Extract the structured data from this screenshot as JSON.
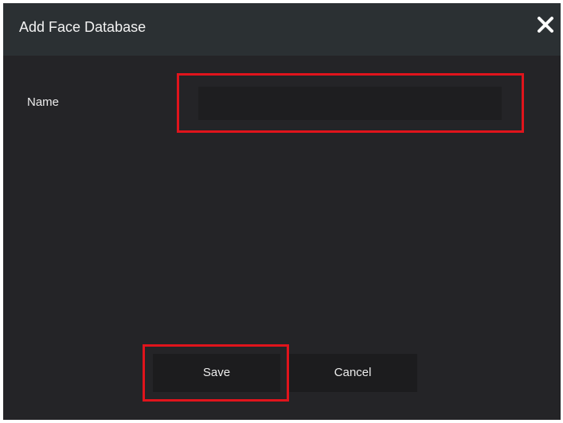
{
  "dialog": {
    "title": "Add Face Database",
    "close_icon": "close-icon"
  },
  "form": {
    "name_label": "Name",
    "name_value": "",
    "name_placeholder": ""
  },
  "buttons": {
    "save_label": "Save",
    "cancel_label": "Cancel"
  },
  "colors": {
    "title_bar": "#2b3033",
    "background": "#242427",
    "highlight": "#e0141c"
  }
}
